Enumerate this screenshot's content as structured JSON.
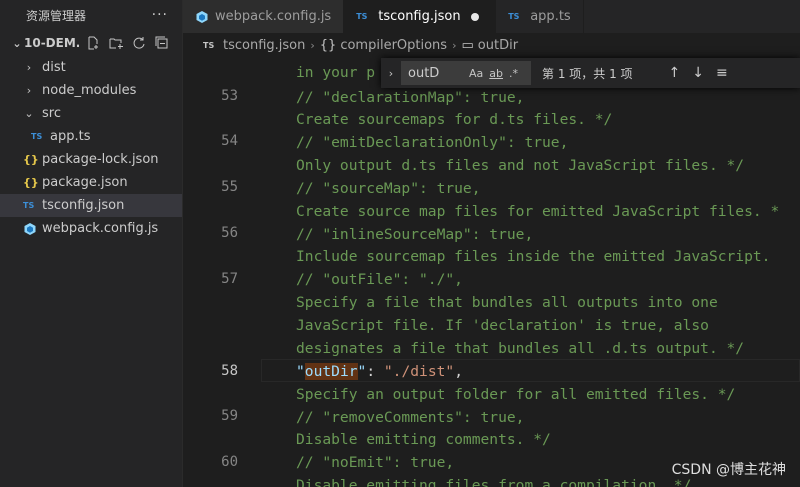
{
  "sidebar": {
    "title": "资源管理器",
    "more": "···",
    "project": "10-DEM...",
    "items": [
      {
        "label": "dist",
        "type": "folder"
      },
      {
        "label": "node_modules",
        "type": "folder"
      },
      {
        "label": "src",
        "type": "folder-open"
      },
      {
        "label": "app.ts",
        "type": "ts"
      },
      {
        "label": "package-lock.json",
        "type": "json"
      },
      {
        "label": "package.json",
        "type": "json"
      },
      {
        "label": "tsconfig.json",
        "type": "ts"
      },
      {
        "label": "webpack.config.js",
        "type": "webpack"
      }
    ]
  },
  "tabs": [
    {
      "label": "webpack.config.js",
      "icon": "webpack-icon"
    },
    {
      "label": "tsconfig.json",
      "icon": "ts-icon",
      "active": true,
      "dirty": true
    },
    {
      "label": "app.ts",
      "icon": "ts-icon"
    }
  ],
  "breadcrumb": {
    "file": "tsconfig.json",
    "obj": "compilerOptions",
    "prop": "outDir"
  },
  "find": {
    "query": "outD",
    "case": "Aa",
    "word": "ab",
    "regex": ".*",
    "count": "第 1 项，共 1 项"
  },
  "editor": {
    "lines": [
      {
        "n": "",
        "text": "in your p"
      },
      {
        "n": "53",
        "text": "// \"declarationMap\": true,"
      },
      {
        "n": "",
        "text": "Create sourcemaps for d.ts files. */"
      },
      {
        "n": "54",
        "text": "// \"emitDeclarationOnly\": true,"
      },
      {
        "n": "",
        "text": "Only output d.ts files and not JavaScript files. */"
      },
      {
        "n": "55",
        "text": "// \"sourceMap\": true,"
      },
      {
        "n": "",
        "text": "Create source map files for emitted JavaScript files. *"
      },
      {
        "n": "56",
        "text": "// \"inlineSourceMap\": true,"
      },
      {
        "n": "",
        "text": "Include sourcemap files inside the emitted JavaScript."
      },
      {
        "n": "57",
        "text": "// \"outFile\": \"./\","
      },
      {
        "n": "",
        "text": "Specify a file that bundles all outputs into one"
      },
      {
        "n": "",
        "text": "JavaScript file. If 'declaration' is true, also"
      },
      {
        "n": "",
        "text": "designates a file that bundles all .d.ts output. */"
      },
      {
        "n": "58",
        "text": "\"outDir\": \"./dist\","
      },
      {
        "n": "",
        "text": "Specify an output folder for all emitted files. */"
      },
      {
        "n": "59",
        "text": "// \"removeComments\": true,"
      },
      {
        "n": "",
        "text": "Disable emitting comments. */"
      },
      {
        "n": "60",
        "text": "// \"noEmit\": true,"
      },
      {
        "n": "",
        "text": "Disable emitting files from a compilation. */"
      }
    ],
    "outdir_key": "outDir",
    "outdir_value": "\"./dist\""
  },
  "watermark": "CSDN @博主花神"
}
